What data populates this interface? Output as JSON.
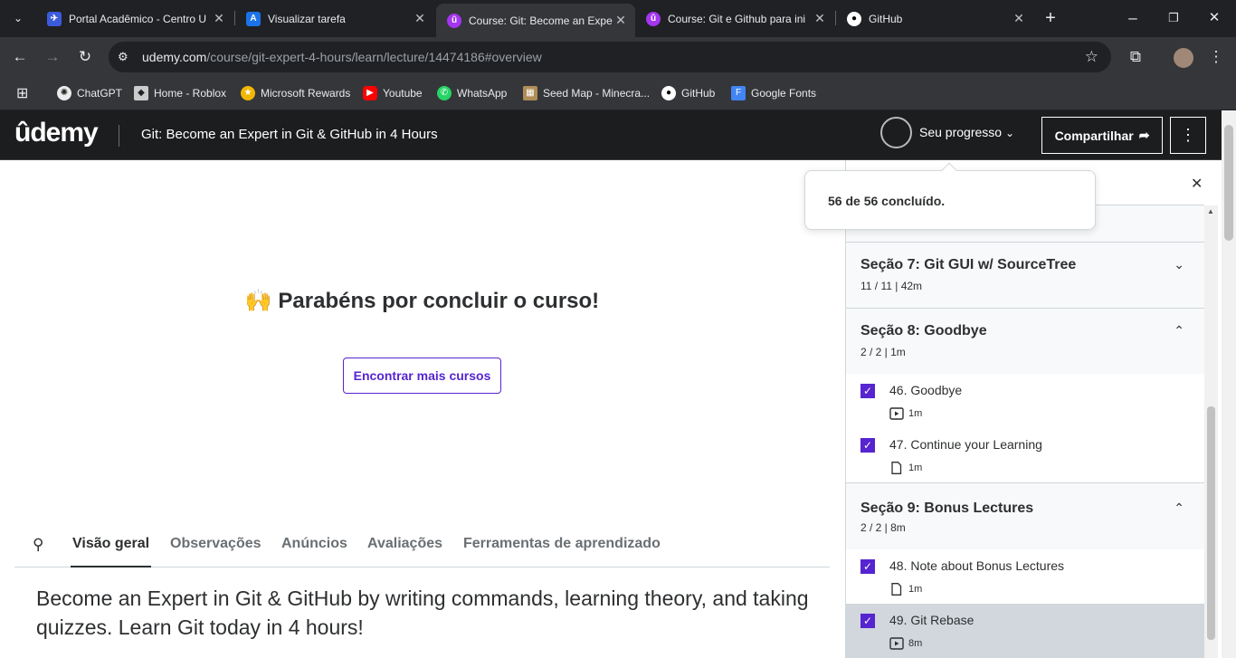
{
  "browser": {
    "tabs": [
      {
        "title": "Portal Acadêmico - Centro U",
        "icon": "portal-icon",
        "color": "#3b5bdb"
      },
      {
        "title": "Visualizar tarefa",
        "icon": "alura-icon",
        "color": "#1a73e8"
      },
      {
        "title": "Course: Git: Become an Expe",
        "icon": "udemy-icon",
        "color": "#a435f0"
      },
      {
        "title": "Course: Git e Github para ini",
        "icon": "udemy-icon",
        "color": "#a435f0"
      },
      {
        "title": "GitHub",
        "icon": "github-icon",
        "color": "#ffffff"
      }
    ],
    "url_host": "udemy.com",
    "url_path": "/course/git-expert-4-hours/learn/lecture/14474186#overview",
    "bookmarks": [
      "ChatGPT",
      "Home - Roblox",
      "Microsoft Rewards",
      "Youtube",
      "WhatsApp",
      "Seed Map - Minecra...",
      "GitHub",
      "Google Fonts"
    ]
  },
  "header": {
    "logo": "ûdemy",
    "course_title": "Git: Become an Expert in Git & GitHub in 4 Hours",
    "progress_label": "Seu progresso",
    "share_label": "Compartilhar"
  },
  "popup": {
    "text": "56 de 56 concluído."
  },
  "main": {
    "congrats": "Parabéns por concluir o curso!",
    "find_more": "Encontrar mais cursos",
    "tabs": [
      "Visão geral",
      "Observações",
      "Anúncios",
      "Avaliações",
      "Ferramentas de aprendizado"
    ],
    "description": "Become an Expert in Git & GitHub by writing commands, learning theory, and taking quizzes. Learn Git today in 4 hours!"
  },
  "sidebar": {
    "sections": [
      {
        "title": "Seção 7: Git GUI w/ SourceTree",
        "meta": "11 / 11 | 42m"
      },
      {
        "title": "Seção 8: Goodbye",
        "meta": "2 / 2 | 1m"
      },
      {
        "title": "Seção 9: Bonus Lectures",
        "meta": "2 / 2 | 8m"
      }
    ],
    "lectures": [
      {
        "title": "46. Goodbye",
        "duration": "1m",
        "kind": "video"
      },
      {
        "title": "47. Continue your Learning",
        "duration": "1m",
        "kind": "article"
      },
      {
        "title": "48. Note about Bonus Lectures",
        "duration": "1m",
        "kind": "article"
      },
      {
        "title": "49. Git Rebase",
        "duration": "8m",
        "kind": "video"
      }
    ]
  },
  "colors": {
    "brand": "#5624d0",
    "header_bg": "#1c1d1f"
  }
}
